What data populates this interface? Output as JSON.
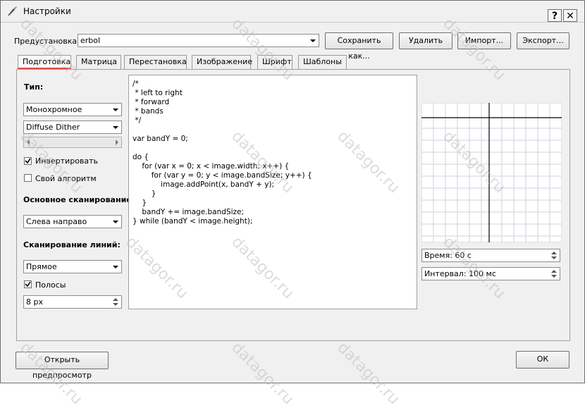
{
  "window": {
    "title": "Настройки",
    "help": "?",
    "close": "✕"
  },
  "preset": {
    "label": "Предустановка:",
    "value": "erbol"
  },
  "buttons": {
    "save_as": "Сохранить как...",
    "delete": "Удалить",
    "import": "Импорт...",
    "export": "Экспорт...",
    "preview": "Открыть предпросмотр",
    "ok": "ОК"
  },
  "tabs": [
    "Подготовка",
    "Матрица",
    "Перестановка",
    "Изображение",
    "Шрифт",
    "Шаблоны"
  ],
  "prep": {
    "type_label": "Тип:",
    "type_value": "Монохромное",
    "dither_value": "Diffuse Dither",
    "invert_label": "Инвертировать",
    "custom_label": "Свой алгоритм",
    "scan_label": "Основное сканирование:",
    "scan_value": "Слева направо",
    "line_scan_label": "Сканирование линий:",
    "line_scan_value": "Прямое",
    "bands_label": "Полосы",
    "bands_value": "8 px"
  },
  "code": [
    "/*",
    " * left to right",
    " * forward",
    " * bands",
    " */",
    "",
    "var bandY = 0;",
    "",
    "do {",
    "    for (var x = 0; x < image.width; x++) {",
    "        for (var y = 0; y < image.bandSize; y++) {",
    "            image.addPoint(x, bandY + y);",
    "        }",
    "    }",
    "    bandY += image.bandSize;",
    "} while (bandY < image.height);"
  ],
  "preview_panel": {
    "time_label": "Время: 60 с",
    "interval_label": "Интервал: 100 мс"
  },
  "watermark": "datagor.ru"
}
